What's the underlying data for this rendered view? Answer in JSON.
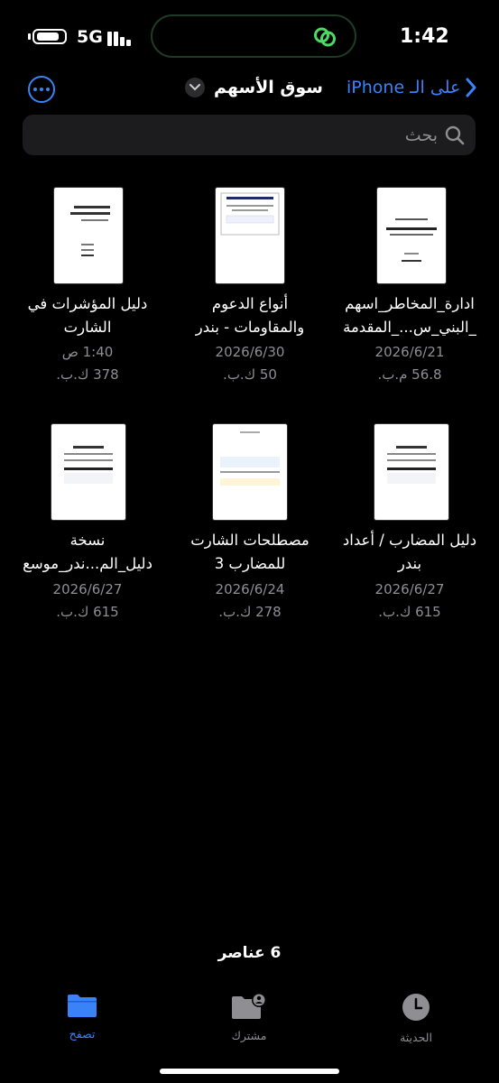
{
  "status": {
    "network": "5G",
    "time": "1:42"
  },
  "nav": {
    "back_label": "على الـ iPhone",
    "title": "سوق الأسهم"
  },
  "search": {
    "placeholder": "بحث"
  },
  "files": [
    {
      "name_line1": "ادارة_المخاطر_اسهم",
      "name_line2": "_البني_س..._المقدمة",
      "date": "2026/6/21",
      "size": "56.8 م.ب."
    },
    {
      "name_line1": "أنواع الدعوم",
      "name_line2": "والمقاومات - بندر",
      "date": "2026/6/30",
      "size": "50 ك.ب."
    },
    {
      "name_line1": "دليل المؤشرات في",
      "name_line2": "الشارت",
      "date": "1:40 ص",
      "size": "378 ك.ب."
    },
    {
      "name_line1": "دليل المضارب / أعداد",
      "name_line2": "بندر",
      "date": "2026/6/27",
      "size": "615 ك.ب."
    },
    {
      "name_line1": "مصطلحات الشارت",
      "name_line2": "للمضارب 3",
      "date": "2026/6/24",
      "size": "278 ك.ب."
    },
    {
      "name_line1": "نسخة",
      "name_line2": "دليل_الم...ندر_موسع",
      "date": "2026/6/27",
      "size": "615 ك.ب."
    }
  ],
  "footer": {
    "item_count": "6 عناصر"
  },
  "tabs": {
    "browse": "تصفح",
    "shared": "مشترك",
    "recents": "الحديثة"
  },
  "colors": {
    "accent": "#3a82f7",
    "secondary_text": "#8e8e93",
    "island_icon": "#4cd964"
  }
}
